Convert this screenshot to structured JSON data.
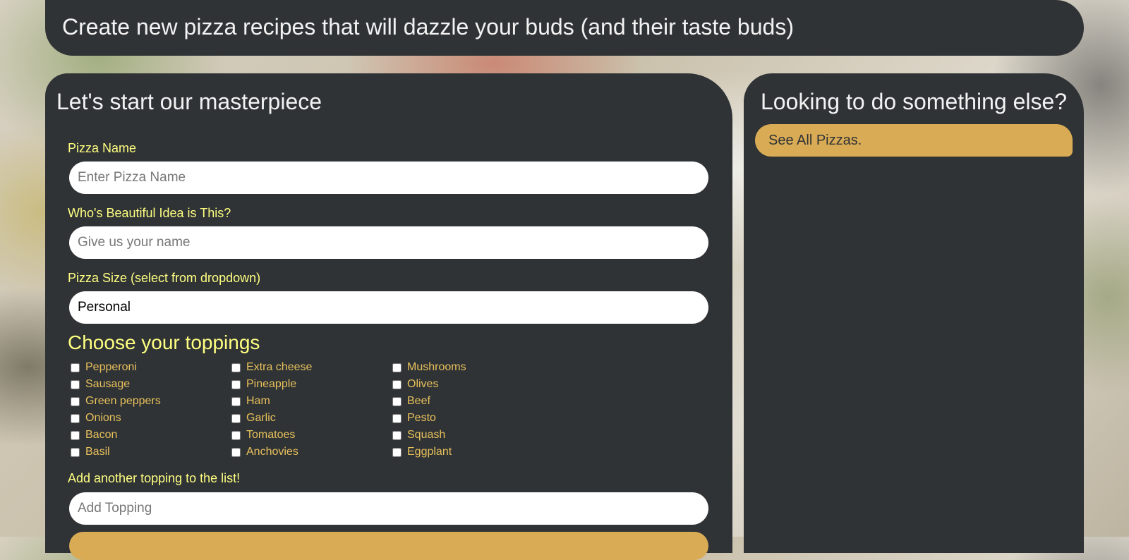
{
  "header": {
    "title": "Create new pizza recipes that will dazzle your buds (and their taste buds)"
  },
  "form": {
    "title": "Let's start our masterpiece",
    "pizza_name": {
      "label": "Pizza Name",
      "placeholder": "Enter Pizza Name",
      "value": ""
    },
    "creator": {
      "label": "Who's Beautiful Idea is This?",
      "placeholder": "Give us your name",
      "value": ""
    },
    "size": {
      "label": "Pizza Size (select from dropdown)",
      "selected": "Personal"
    },
    "toppings_title": "Choose your toppings",
    "toppings": [
      [
        "Pepperoni",
        "Extra cheese",
        "Mushrooms"
      ],
      [
        "Sausage",
        "Pineapple",
        "Olives"
      ],
      [
        "Green peppers",
        "Ham",
        "Beef"
      ],
      [
        "Onions",
        "Garlic",
        "Pesto"
      ],
      [
        "Bacon",
        "Tomatoes",
        "Squash"
      ],
      [
        "Basil",
        "Anchovies",
        "Eggplant"
      ]
    ],
    "add_topping": {
      "label": "Add another topping to the list!",
      "placeholder": "Add Topping",
      "value": ""
    }
  },
  "sidebar": {
    "title": "Looking to do something else?",
    "see_all_label": "See All Pizzas."
  }
}
